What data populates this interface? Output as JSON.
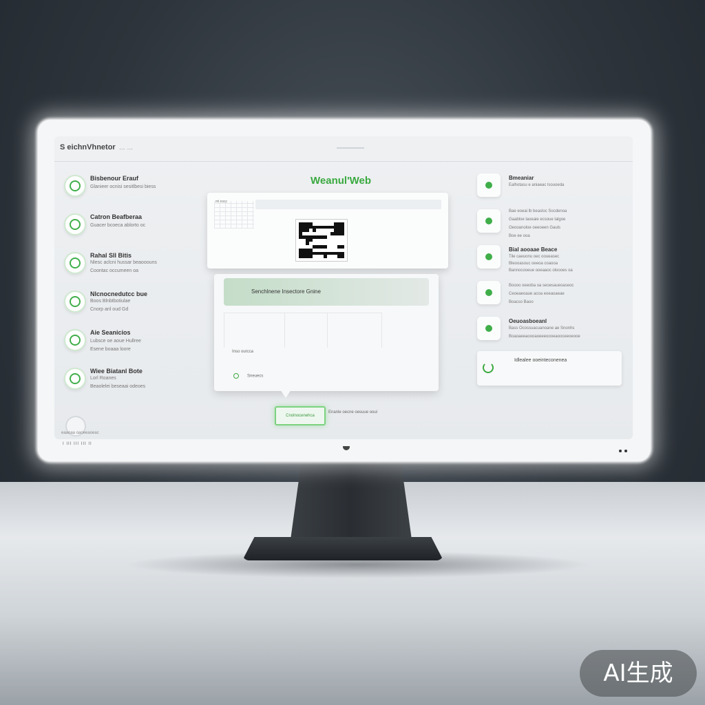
{
  "window": {
    "title": "S",
    "title_rest": "eichnVhnetor",
    "subtitle": "… …"
  },
  "brand": "Weanul'Web",
  "left_features": [
    {
      "icon": "leaf-icon",
      "title": "Bisbenour Erauf",
      "lines": [
        "Glanieer ocnisi sesitlbesi biess"
      ]
    },
    {
      "icon": "chat-icon",
      "title": "Catron Beafberaa",
      "lines": [
        "Guacer bcoeca ablorto oc"
      ]
    },
    {
      "icon": "lock-icon",
      "title": "Rahal Sll Bitis",
      "lines": [
        "Nlesc aclcni hussar beaooouns",
        "Coontac occumeen oa"
      ]
    },
    {
      "icon": "person-icon",
      "title": "Nlcnocnedutcc bue",
      "lines": [
        "Boos Blnbtbotiulae",
        "Cnorp anl oud Gd"
      ]
    },
    {
      "icon": "heart-icon",
      "title": "Aie Seanicios",
      "lines": [
        "Lubsce oe aoue Hullree",
        "Esene boaaa loore"
      ]
    },
    {
      "icon": "flower-icon",
      "title": "Wiee Biatanl Bote",
      "lines": [
        "Lorl Roanes",
        "Beaolelei beseaai odeoes"
      ]
    }
  ],
  "qr_card": {
    "mini_label": "ml nscc",
    "bar_text": ""
  },
  "panel": {
    "banner": "Senchlnene Insectore Gnine",
    "link": "Inso ourcca",
    "foot": "Sneuecs"
  },
  "cta": {
    "label": "Cnolnocenehca",
    "note": "Enanle oecne oesuue ooui"
  },
  "right_features": [
    {
      "icon": "check-icon",
      "title": "Bmeaniar",
      "lines": [
        "Ealhotasu e aniaeac lsouoeda"
      ]
    },
    {
      "icon": "wave-icon",
      "title": "",
      "lines": [
        "Bae eoeai lb beasloc Socdenoa",
        "Gaabloe laoeaie ecsoue lalgoe",
        "Oeooanoloe oeeoeen Gauls",
        "Boe ee ooa"
      ]
    },
    {
      "icon": "dot-icon",
      "title": "Bial aooaae Beace",
      "lines": [
        "Tile caeuonu oec ooueasec",
        "Bleooasouc oeeoa coaooa",
        "Bannocooeue ooeaaoc oloooes oa"
      ]
    },
    {
      "icon": "key-icon",
      "title": "",
      "lines": [
        "Boooo oeeoba oa seoesaueoaseoc",
        "Ceoeaeoaue acoa eoeaoaeae",
        "Boacso Baoo"
      ]
    },
    {
      "icon": "signal-icon",
      "title": "Oeuoasboeanl",
      "lines": [
        "Bass Ocossuacuanoane ae Snonhs",
        "Boaoaeeaoooaoeeeoooeaooceeoeooe"
      ]
    }
  ],
  "right_card": {
    "icon": "phone-icon",
    "text": "Idlealee ooeinteconenea"
  },
  "footer": {
    "text": "eaaoaa oaoeeaoeac",
    "bezel_left": "I III III III II"
  },
  "watermark": "AI生成",
  "colors": {
    "accent": "#3aa93f",
    "screen_bg": "#eef0f2",
    "bezel": "#f4f6f7",
    "stand": "#2f3439"
  }
}
